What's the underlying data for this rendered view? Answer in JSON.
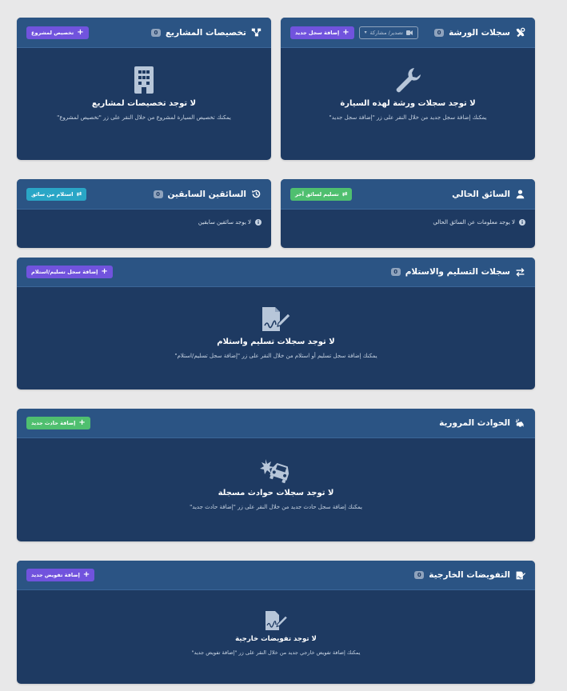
{
  "workshop": {
    "title": "سجلات الورشة",
    "count": "0",
    "add_label": "إضافة سجل جديد",
    "export_label": "تصدير/ مشاركة",
    "empty_title": "لا توجد سجلات ورشة لهذه السيارة",
    "empty_desc": "يمكنك إضافة سجل جديد من خلال النقر على زر \"إضافة سجل جديد\""
  },
  "projects": {
    "title": "تخصيصات المشاريع",
    "count": "0",
    "add_label": "تخصيص لمشروع",
    "empty_title": "لا توجد تخصيصات لمشاريع",
    "empty_desc": "يمكنك تخصيص السيارة لمشروع من خلال النقر على زر \"تخصيص لمشروع\""
  },
  "current_driver": {
    "title": "السائق الحالي",
    "assign_label": "تسليم لسائق آخر",
    "info": "لا يوجد معلومات عن السائق الحالي"
  },
  "previous_drivers": {
    "title": "السائقين السابقين",
    "count": "0",
    "receive_label": "استلام من سائق",
    "info": "لا يوجد سائقين سابقين"
  },
  "handover": {
    "title": "سجلات التسليم والاستلام",
    "count": "0",
    "add_label": "إضافة سجل تسليم/استلام",
    "empty_title": "لا توجد سجلات تسليم واستلام",
    "empty_desc": "يمكنك إضافة سجل تسليم أو استلام من خلال النقر على زر \"إضافة سجل تسليم/استلام\""
  },
  "accidents": {
    "title": "الحوادث المرورية",
    "add_label": "إضافة حادث جديد",
    "empty_title": "لا توجد سجلات حوادث مسجلة",
    "empty_desc": "يمكنك إضافة سجل حادث جديد من خلال النقر على زر \"إضافة حادث جديد\""
  },
  "authorizations": {
    "title": "التفويضات الخارجية",
    "count": "0",
    "add_label": "إضافة تفويض جديد",
    "empty_title": "لا توجد تفويضات خارجية",
    "empty_desc": "يمكنك إضافة تفويض خارجي جديد من خلال النقر على زر \"إضافة تفويض جديد\""
  },
  "icons": {
    "workshop": "tools-icon",
    "projects": "project-diagram-icon",
    "current_driver": "user-icon",
    "previous_drivers": "history-icon",
    "handover": "exchange-icon",
    "accidents": "car-crash-icon",
    "authorizations": "signature-icon"
  },
  "colors": {
    "page_bg": "#e8e8e9",
    "card_bg": "#1e3a62",
    "header_bg": "#2b5484",
    "purple": "#7153dd",
    "green": "#4fbf6f",
    "teal": "#2aa6c6"
  }
}
